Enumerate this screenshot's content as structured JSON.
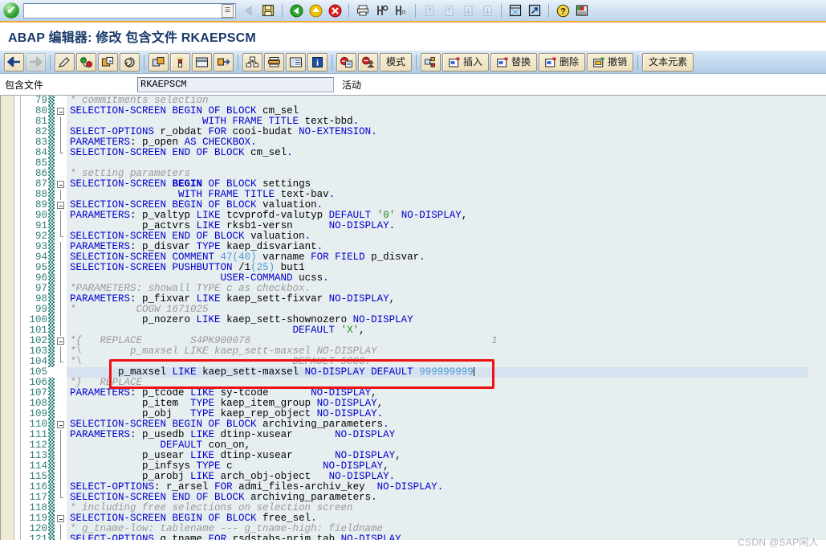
{
  "window": {
    "title": "ABAP 编辑器: 修改 包含文件 RKAEPSCM"
  },
  "command_bar": {
    "ok_icon": "check-circle-icon",
    "command_field_value": "",
    "command_field_placeholder": "",
    "dropdown_icon": "command-history-icon",
    "icons": [
      {
        "name": "back-arrow-icon",
        "tooltip": "后退",
        "disabled": true
      },
      {
        "name": "save-icon",
        "tooltip": "保存",
        "disabled": false
      },
      {
        "name": "green-back-icon",
        "tooltip": "返回",
        "disabled": false
      },
      {
        "name": "yellow-up-icon",
        "tooltip": "退出",
        "disabled": false
      },
      {
        "name": "red-cancel-icon",
        "tooltip": "取消",
        "disabled": false
      },
      {
        "name": "print-icon",
        "tooltip": "打印",
        "disabled": false
      },
      {
        "name": "find-icon",
        "tooltip": "查找",
        "disabled": false
      },
      {
        "name": "find-next-icon",
        "tooltip": "查找下一个",
        "disabled": false
      },
      {
        "name": "first-page-icon",
        "tooltip": "首页",
        "disabled": true
      },
      {
        "name": "previous-page-icon",
        "tooltip": "上一页",
        "disabled": true
      },
      {
        "name": "next-page-icon",
        "tooltip": "下一页",
        "disabled": true
      },
      {
        "name": "last-page-icon",
        "tooltip": "末页",
        "disabled": true
      },
      {
        "name": "new-session-icon",
        "tooltip": "创建新会话",
        "disabled": false
      },
      {
        "name": "shortcut-icon",
        "tooltip": "创建快捷方式",
        "disabled": false
      },
      {
        "name": "help-icon",
        "tooltip": "帮助",
        "disabled": false
      },
      {
        "name": "layout-menu-icon",
        "tooltip": "自定义本地布局",
        "disabled": false
      }
    ]
  },
  "app_toolbar": {
    "buttons": [
      {
        "name": "display-change-back-icon",
        "label": "",
        "icon": "left-arrow-icon",
        "disabled": false
      },
      {
        "name": "forward-icon",
        "label": "",
        "icon": "right-arrow-icon",
        "disabled": true
      },
      {
        "name": "display-change-icon",
        "label": "",
        "icon": "pencil-icon",
        "disabled": false
      },
      {
        "name": "check-icon",
        "label": "",
        "icon": "syntax-check-icon",
        "disabled": false
      },
      {
        "name": "activate-icon",
        "label": "",
        "icon": "activate-box-icon",
        "disabled": false
      },
      {
        "name": "pattern-icon",
        "label": "",
        "icon": "spiral-icon",
        "disabled": false
      },
      {
        "name": "object-list-icon",
        "label": "",
        "icon": "object-navigator-icon",
        "disabled": false
      },
      {
        "name": "where-used-icon",
        "label": "",
        "icon": "torch-icon",
        "disabled": false
      },
      {
        "name": "split-screen-icon",
        "label": "",
        "icon": "window-split-icon",
        "disabled": false
      },
      {
        "name": "navigate-icon",
        "label": "",
        "icon": "arrows-cross-icon",
        "disabled": false
      },
      {
        "name": "hierarchy-icon",
        "label": "",
        "icon": "tree-icon",
        "disabled": false
      },
      {
        "name": "stack-icon",
        "label": "",
        "icon": "layers-icon",
        "disabled": false
      },
      {
        "name": "list-icon",
        "label": "",
        "icon": "table-list-icon",
        "disabled": false
      },
      {
        "name": "info-icon",
        "label": "",
        "icon": "blue-info-icon",
        "disabled": false
      },
      {
        "name": "debug-icon",
        "label": "",
        "icon": "red-book-icon",
        "disabled": false
      },
      {
        "name": "user-debug-icon",
        "label": "",
        "icon": "red-user-icon",
        "disabled": false
      },
      {
        "name": "mode-button",
        "label": "模式",
        "icon": "",
        "disabled": false
      },
      {
        "name": "pattern2-icon",
        "label": "",
        "icon": "pattern-block-icon",
        "disabled": false
      },
      {
        "name": "insert-button",
        "label": "插入",
        "icon": "insert-icon",
        "disabled": false
      },
      {
        "name": "replace-button",
        "label": "替换",
        "icon": "replace-icon",
        "disabled": false
      },
      {
        "name": "delete-button",
        "label": "删除",
        "icon": "delete-icon",
        "disabled": false
      },
      {
        "name": "undo-button",
        "label": "撤销",
        "icon": "undo-icon",
        "disabled": false
      },
      {
        "name": "text-elements-button",
        "label": "文本元素",
        "icon": "",
        "disabled": false
      }
    ]
  },
  "object_row": {
    "label": "包含文件",
    "value": "RKAEPSCM",
    "status": "活动"
  },
  "editor": {
    "lines": [
      {
        "no": "79",
        "fold": "none",
        "html": "<span class=\"c\">* commitments selection</span>"
      },
      {
        "no": "80",
        "fold": "minus",
        "html": "<span class=\"k\">SELECTION-SCREEN BEGIN OF BLOCK</span> <span class=\"v\">cm_sel</span>"
      },
      {
        "no": "81",
        "fold": "line",
        "html": "                      <span class=\"k\">WITH FRAME TITLE</span> <span class=\"v\">text</span>-<span class=\"v\">bbd</span><span class=\"k\">.</span>"
      },
      {
        "no": "82",
        "fold": "line",
        "html": "<span class=\"k\">SELECT-OPTIONS</span> <span class=\"v\">r_obdat</span> <span class=\"k\">FOR</span> <span class=\"v\">cooi</span>-<span class=\"v\">budat</span> <span class=\"k\">NO-EXTENSION</span><span class=\"k\">.</span>"
      },
      {
        "no": "83",
        "fold": "line",
        "html": "<span class=\"k\">PARAMETERS</span>: <span class=\"v\">p_open</span> <span class=\"k\">AS CHECKBOX</span><span class=\"k\">.</span>"
      },
      {
        "no": "84",
        "fold": "end",
        "html": "<span class=\"k\">SELECTION-SCREEN END OF BLOCK</span> <span class=\"v\">cm_sel</span><span class=\"k\">.</span>"
      },
      {
        "no": "85",
        "fold": "none",
        "html": ""
      },
      {
        "no": "86",
        "fold": "none",
        "html": "<span class=\"c\">* setting parameters</span>"
      },
      {
        "no": "87",
        "fold": "minus",
        "html": "<span class=\"k\">SELECTION-SCREEN <span class=\"b\">BEGIN</span> OF BLOCK</span> <span class=\"v\">settings</span>"
      },
      {
        "no": "88",
        "fold": "line",
        "html": "                  <span class=\"k\">WITH FRAME TITLE</span> <span class=\"v\">text</span>-<span class=\"v\">bav</span><span class=\"k\">.</span>"
      },
      {
        "no": "89",
        "fold": "minus",
        "html": "<span class=\"k\">SELECTION-SCREEN BEGIN OF BLOCK</span> <span class=\"v\">valuation</span><span class=\"k\">.</span>"
      },
      {
        "no": "90",
        "fold": "line",
        "html": "<span class=\"k\">PARAMETERS</span>: <span class=\"v\">p_valtyp</span> <span class=\"k\">LIKE</span> <span class=\"v\">tcvprofd</span>-<span class=\"v\">valutyp</span> <span class=\"k\">DEFAULT</span> <span class=\"s\">'0'</span> <span class=\"k\">NO-DISPLAY</span>,"
      },
      {
        "no": "91",
        "fold": "line",
        "html": "            <span class=\"v\">p_actvrs</span> <span class=\"k\">LIKE</span> <span class=\"v\">rksb1</span>-<span class=\"v\">versn</span>      <span class=\"k\">NO-DISPLAY</span><span class=\"k\">.</span>"
      },
      {
        "no": "92",
        "fold": "end",
        "html": "<span class=\"k\">SELECTION-SCREEN END OF BLOCK</span> <span class=\"v\">valuation</span><span class=\"k\">.</span>"
      },
      {
        "no": "93",
        "fold": "line",
        "html": "<span class=\"k\">PARAMETERS</span>: <span class=\"v\">p_disvar</span> <span class=\"k\">TYPE</span> <span class=\"v\">kaep_disvariant</span><span class=\"k\">.</span>"
      },
      {
        "no": "94",
        "fold": "line",
        "html": "<span class=\"k\">SELECTION-SCREEN COMMENT</span> <span class=\"n\">47(40)</span> <span class=\"v\">varname</span> <span class=\"k\">FOR FIELD</span> <span class=\"v\">p_disvar</span><span class=\"k\">.</span>"
      },
      {
        "no": "95",
        "fold": "line",
        "html": "<span class=\"k\">SELECTION-SCREEN PUSHBUTTON</span> <span class=\"v\">/1</span><span class=\"n\">(25)</span> <span class=\"v\">but1</span>"
      },
      {
        "no": "96",
        "fold": "line",
        "html": "                         <span class=\"k\">USER-COMMAND</span> <span class=\"v\">ucss</span><span class=\"k\">.</span>"
      },
      {
        "no": "97",
        "fold": "line",
        "html": "<span class=\"c\">*PARAMETERS: showall TYPE c as checkbox.</span>"
      },
      {
        "no": "98",
        "fold": "line",
        "html": "<span class=\"k\">PARAMETERS</span>: <span class=\"v\">p_fixvar</span> <span class=\"k\">LIKE</span> <span class=\"v\">kaep_sett</span>-<span class=\"v\">fixvar</span> <span class=\"k\">NO-DISPLAY</span>,"
      },
      {
        "no": "99",
        "fold": "line",
        "html": "<span class=\"c\">*          COGW 1671025</span>"
      },
      {
        "no": "100",
        "fold": "line",
        "html": "            <span class=\"v\">p_nozero</span> <span class=\"k\">LIKE</span> <span class=\"v\">kaep_sett</span>-<span class=\"v\">shownozero</span> <span class=\"k\">NO-DISPLAY</span>"
      },
      {
        "no": "101",
        "fold": "line",
        "html": "                                     <span class=\"k\">DEFAULT</span> <span class=\"s\">'X'</span>,"
      },
      {
        "no": "102",
        "fold": "minus",
        "html": "<span class=\"c\">*{   REPLACE        S4PK900078                                        1</span>"
      },
      {
        "no": "103",
        "fold": "line",
        "html": "<span class=\"c\">*\\        p_maxsel LIKE kaep_sett-maxsel NO-DISPLAY</span>"
      },
      {
        "no": "104",
        "fold": "end",
        "html": "<span class=\"c\">*\\                                   DEFAULT 5000.</span>"
      },
      {
        "no": "105",
        "fold": "none",
        "cur": true,
        "html": "        <span class=\"v\">p_maxsel</span> <span class=\"k\">LIKE</span> <span class=\"v\">kaep_sett</span>-<span class=\"v\">maxsel</span> <span class=\"k\">NO-DISPLAY DEFAULT</span> <span class=\"n\">999999999</span><span class=\"caret\"></span>"
      },
      {
        "no": "106",
        "fold": "none",
        "html": "<span class=\"c\">*}   REPLACE</span>"
      },
      {
        "no": "107",
        "fold": "none",
        "html": "<span class=\"k\">PARAMETERS</span>: <span class=\"v\">p_tcode</span> <span class=\"k\">LIKE</span> <span class=\"v\">sy</span>-<span class=\"v\">tcode</span>       <span class=\"k\">NO-DISPLAY</span>,"
      },
      {
        "no": "108",
        "fold": "none",
        "html": "            <span class=\"v\">p_item</span>  <span class=\"k\">TYPE</span> <span class=\"v\">kaep_item_group</span> <span class=\"k\">NO-DISPLAY</span>,"
      },
      {
        "no": "109",
        "fold": "none",
        "html": "            <span class=\"v\">p_obj</span>   <span class=\"k\">TYPE</span> <span class=\"v\">kaep_rep_object</span> <span class=\"k\">NO-DISPLAY</span><span class=\"k\">.</span>"
      },
      {
        "no": "110",
        "fold": "minus",
        "html": "<span class=\"k\">SELECTION-SCREEN BEGIN OF BLOCK</span> <span class=\"v\">archiving_parameters</span><span class=\"k\">.</span>"
      },
      {
        "no": "111",
        "fold": "line",
        "html": "<span class=\"k\">PARAMETERS</span>: <span class=\"v\">p_usedb</span> <span class=\"k\">LIKE</span> <span class=\"v\">dtinp</span>-<span class=\"v\">xusear</span>       <span class=\"k\">NO-DISPLAY</span>"
      },
      {
        "no": "112",
        "fold": "line",
        "html": "               <span class=\"k\">DEFAULT</span> <span class=\"v\">con_on</span>,"
      },
      {
        "no": "113",
        "fold": "line",
        "html": "            <span class=\"v\">p_usear</span> <span class=\"k\">LIKE</span> <span class=\"v\">dtinp</span>-<span class=\"v\">xusear</span>       <span class=\"k\">NO-DISPLAY</span>,"
      },
      {
        "no": "114",
        "fold": "line",
        "html": "            <span class=\"v\">p_infsys</span> <span class=\"k\">TYPE</span> <span class=\"v\">c</span>               <span class=\"k\">NO-DISPLAY</span>,"
      },
      {
        "no": "115",
        "fold": "line",
        "html": "            <span class=\"v\">p_arobj</span> <span class=\"k\">LIKE</span> <span class=\"v\">arch_obj</span>-<span class=\"v\">object</span>   <span class=\"k\">NO-DISPLAY</span><span class=\"k\">.</span>"
      },
      {
        "no": "116",
        "fold": "line",
        "html": "<span class=\"k\">SELECT-OPTIONS</span>: <span class=\"v\">r_arsel</span> <span class=\"k\">FOR</span> <span class=\"v\">admi_files</span>-<span class=\"v\">archiv_key</span>  <span class=\"k\">NO-DISPLAY</span><span class=\"k\">.</span>"
      },
      {
        "no": "117",
        "fold": "end",
        "html": "<span class=\"k\">SELECTION-SCREEN END OF BLOCK</span> <span class=\"v\">archiving_parameters</span><span class=\"k\">.</span>"
      },
      {
        "no": "118",
        "fold": "none",
        "html": "<span class=\"c\">* including free selections on selection screen</span>"
      },
      {
        "no": "119",
        "fold": "minus",
        "html": "<span class=\"k\">SELECTION-SCREEN BEGIN OF BLOCK</span> <span class=\"v\">free_sel</span><span class=\"k\">.</span>"
      },
      {
        "no": "120",
        "fold": "line",
        "html": "<span class=\"c\">* g_tname-low: tablename --- g_tname-high: fieldname</span>"
      },
      {
        "no": "121",
        "fold": "line",
        "html": "<span class=\"k\">SELECT-OPTIONS</span> <span class=\"v\">g_tname</span> <span class=\"k\">FOR</span> <span class=\"v\">rsdstabs</span>-<span class=\"v\">prim_tab</span> <span class=\"k\">NO-DISPLAY</span><span class=\"k\">.</span>"
      }
    ],
    "annotation": {
      "name": "red-highlight-rectangle",
      "color": "#ee1111"
    }
  },
  "watermark": {
    "text": "CSDN @SAP闲人"
  }
}
